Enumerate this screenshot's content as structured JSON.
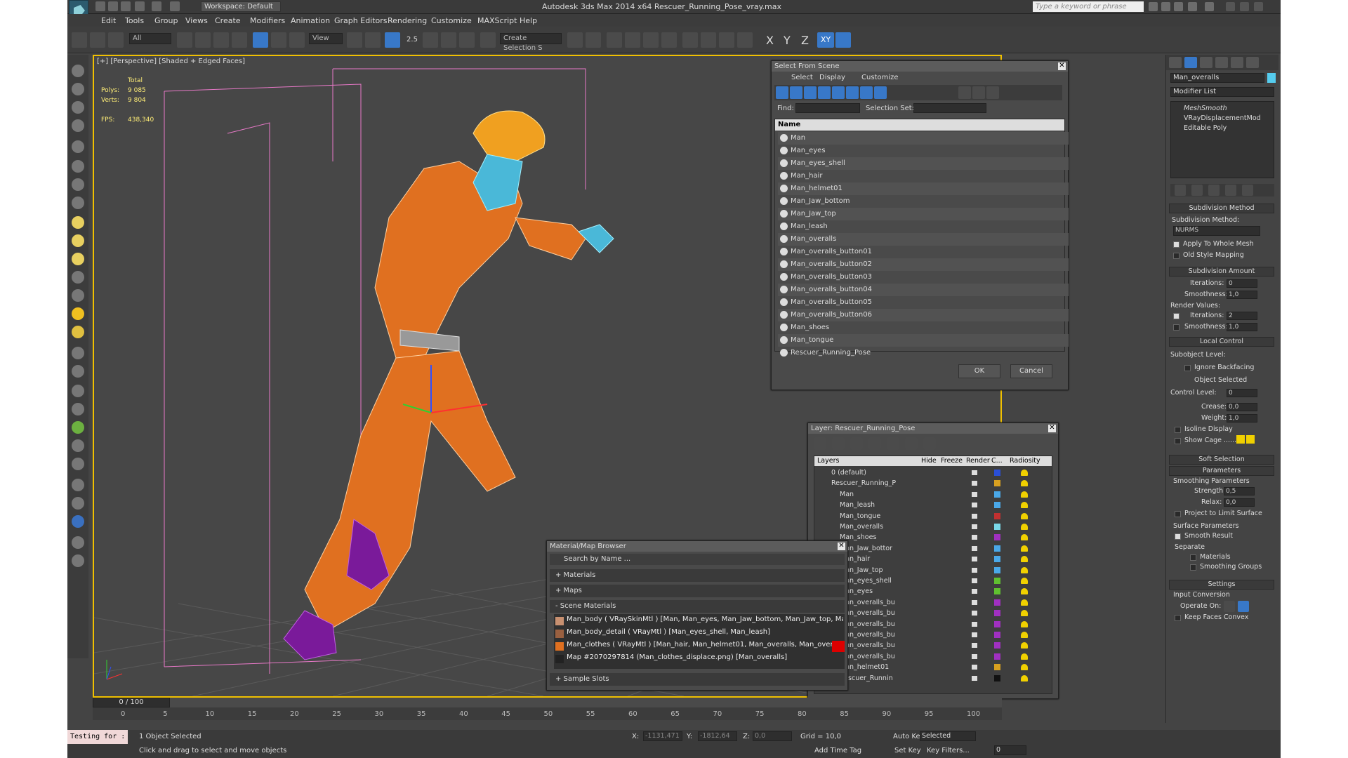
{
  "app": {
    "title": "Autodesk 3ds Max  2014 x64     Rescuer_Running_Pose_vray.max",
    "workspace": "Workspace: Default",
    "search_placeholder": "Type a keyword or phrase"
  },
  "menu": [
    "Edit",
    "Tools",
    "Group",
    "Views",
    "Create",
    "Modifiers",
    "Animation",
    "Graph Editors",
    "Rendering",
    "Customize",
    "MAXScript",
    "Help"
  ],
  "toolbar": {
    "filter": "All",
    "view": "View",
    "snap_angle": "2.5",
    "selection_set": "Create Selection S",
    "axes": [
      "X",
      "Y",
      "Z",
      "XY"
    ]
  },
  "viewport": {
    "label": "[+] [Perspective] [Shaded + Edged Faces]",
    "stats": {
      "total": "Total",
      "polys_label": "Polys:",
      "polys": "9 085",
      "verts_label": "Verts:",
      "verts": "9 804",
      "fps_label": "FPS:",
      "fps": "438,340"
    }
  },
  "select_from_scene": {
    "title": "Select From Scene",
    "menu": [
      "Select",
      "Display",
      "Customize"
    ],
    "find_label": "Find:",
    "selection_set_label": "Selection Set:",
    "column": "Name",
    "items": [
      "Man",
      "Man_eyes",
      "Man_eyes_shell",
      "Man_hair",
      "Man_helmet01",
      "Man_Jaw_bottom",
      "Man_Jaw_top",
      "Man_leash",
      "Man_overalls",
      "Man_overalls_button01",
      "Man_overalls_button02",
      "Man_overalls_button03",
      "Man_overalls_button04",
      "Man_overalls_button05",
      "Man_overalls_button06",
      "Man_shoes",
      "Man_tongue",
      "Rescuer_Running_Pose"
    ],
    "ok": "OK",
    "cancel": "Cancel"
  },
  "layer_dialog": {
    "title": "Layer: Rescuer_Running_Pose",
    "columns": [
      "Layers",
      "Hide",
      "Freeze",
      "Render",
      "C...",
      "Radiosity"
    ],
    "rows": [
      {
        "name": "0 (default)",
        "color": "#2a4fd8"
      },
      {
        "name": "Rescuer_Running_P",
        "color": "#d8a020"
      },
      {
        "name": "Man",
        "color": "#4aa8e8"
      },
      {
        "name": "Man_leash",
        "color": "#4aa8e8"
      },
      {
        "name": "Man_tongue",
        "color": "#c03030"
      },
      {
        "name": "Man_overalls",
        "color": "#7ad8e8"
      },
      {
        "name": "Man_shoes",
        "color": "#a030c0"
      },
      {
        "name": "Man_Jaw_bottor",
        "color": "#4aa8e8"
      },
      {
        "name": "Man_hair",
        "color": "#4aa8e8"
      },
      {
        "name": "Man_Jaw_top",
        "color": "#4aa8e8"
      },
      {
        "name": "Man_eyes_shell",
        "color": "#60c030"
      },
      {
        "name": "Man_eyes",
        "color": "#60c030"
      },
      {
        "name": "Man_overalls_bu",
        "color": "#a030c0"
      },
      {
        "name": "Man_overalls_bu",
        "color": "#a030c0"
      },
      {
        "name": "Man_overalls_bu",
        "color": "#a030c0"
      },
      {
        "name": "Man_overalls_bu",
        "color": "#a030c0"
      },
      {
        "name": "Man_overalls_bu",
        "color": "#a030c0"
      },
      {
        "name": "Man_overalls_bu",
        "color": "#a030c0"
      },
      {
        "name": "Man_helmet01",
        "color": "#d8a020"
      },
      {
        "name": "Rescuer_Runnin",
        "color": "#111111"
      }
    ]
  },
  "material_browser": {
    "title": "Material/Map Browser",
    "search": "Search by Name ...",
    "sections": [
      "+ Materials",
      "+ Maps",
      "- Scene Materials"
    ],
    "scene_materials": [
      "Man_body  ( VRaySkinMtl ) [Man, Man_eyes, Man_Jaw_bottom, Man_Jaw_top, Ma...",
      "Man_body_detail  ( VRayMtl ) [Man_eyes_shell, Man_leash]",
      "Man_clothes  ( VRayMtl ) [Man_hair, Man_helmet01, Man_overalls, Man_overalls_...",
      "Map #2070297814 (Man_clothes_displace.png) [Man_overalls]"
    ],
    "sample_slots": "+ Sample Slots"
  },
  "command_panel": {
    "object_name": "Man_overalls",
    "modifier_list": "Modifier List",
    "stack": [
      "MeshSmooth",
      "VRayDisplacementMod",
      "Editable Poly"
    ],
    "subdivision_method_header": "Subdivision Method",
    "subdivision_method_label": "Subdivision Method:",
    "subdivision_method_value": "NURMS",
    "apply_whole_mesh": "Apply To Whole Mesh",
    "old_style": "Old Style Mapping",
    "subdivision_amount_header": "Subdivision Amount",
    "iterations_label": "Iterations:",
    "iterations": "0",
    "smoothness_label": "Smoothness:",
    "smoothness": "1,0",
    "render_values": "Render Values:",
    "render_iterations": "2",
    "render_smoothness": "1,0",
    "local_control": "Local Control",
    "subobject_level": "Subobject Level:",
    "ignore_backfacing": "Ignore Backfacing",
    "object_selected": "Object Selected",
    "control_level": "Control Level:",
    "control_level_value": "0",
    "crease": "Crease:",
    "crease_value": "0,0",
    "weight": "Weight:",
    "weight_value": "1,0",
    "isoline": "Isoline Display",
    "show_cage": "Show Cage ......",
    "soft_selection": "Soft Selection",
    "parameters": "Parameters",
    "smoothing_params": "Smoothing Parameters",
    "strength": "Strength:",
    "strength_value": "0,5",
    "relax": "Relax:",
    "relax_value": "0,0",
    "project_limit": "Project to Limit Surface",
    "surface_params": "Surface Parameters",
    "smooth_result": "Smooth Result",
    "separate": "Separate",
    "materials": "Materials",
    "smoothing_groups": "Smoothing Groups",
    "settings": "Settings",
    "input_conversion": "Input Conversion",
    "operate_on": "Operate On:",
    "keep_faces_convex": "Keep Faces Convex"
  },
  "timeline": {
    "frame": "0 / 100",
    "ticks": [
      "0",
      "5",
      "10",
      "15",
      "20",
      "25",
      "30",
      "35",
      "40",
      "45",
      "50",
      "55",
      "60",
      "65",
      "70",
      "75",
      "80",
      "85",
      "90",
      "95",
      "100"
    ]
  },
  "status": {
    "listener": "Testing for :",
    "selected": "1 Object Selected",
    "prompt": "Click and drag to select and move objects",
    "x_label": "X:",
    "x": "-1131,471",
    "y_label": "Y:",
    "y": "-1812,64",
    "z_label": "Z:",
    "z": "0,0",
    "grid": "Grid = 10,0",
    "add_time_tag": "Add Time Tag",
    "auto_key": "Auto Key",
    "selected_combo": "Selected",
    "set_key": "Set Key",
    "key_filters": "Key Filters...",
    "frame_value": "0"
  }
}
